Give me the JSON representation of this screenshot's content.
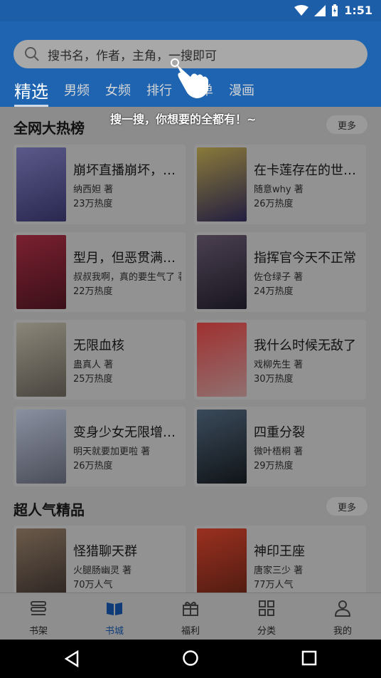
{
  "status": {
    "time": "1:51"
  },
  "search": {
    "placeholder": "搜书名，作者，主角，一搜即可"
  },
  "tabs": [
    "精选",
    "男频",
    "女频",
    "排行",
    "书单",
    "漫画"
  ],
  "guide": {
    "text": "搜一搜，你想要的全都有！~"
  },
  "sections": [
    {
      "title": "全网大热榜",
      "more": "更多",
      "books": [
        {
          "title": "崩坏直播崩坏，芽…",
          "author": "纳西妲 著",
          "heat": "23万热度",
          "cover_color": "#3a3560"
        },
        {
          "title": "在卡莲存在的世界…",
          "author": "随意why 著",
          "heat": "26万热度",
          "cover_color": "#2c2850"
        },
        {
          "title": "型月，但恶贯满盈…",
          "author": "叔叔我啊，真的要生气了 著",
          "heat": "22万热度",
          "cover_color": "#5a1c24"
        },
        {
          "title": "指挥官今天不正常",
          "author": "佐仓绿子 著",
          "heat": "24万热度",
          "cover_color": "#2a2530"
        },
        {
          "title": "无限血核",
          "author": "蛊真人 著",
          "heat": "25万热度",
          "cover_color": "#6e6a60"
        },
        {
          "title": "我什么时候无敌了",
          "author": "戏柳先生 著",
          "heat": "30万热度",
          "cover_color": "#8a2a2a"
        },
        {
          "title": "变身少女无限增殖…",
          "author": "明天就要加更啦 著",
          "heat": "26万热度",
          "cover_color": "#6a7080"
        },
        {
          "title": "四重分裂",
          "author": "微叶梧桐 著",
          "heat": "29万热度",
          "cover_color": "#1e2430"
        }
      ]
    },
    {
      "title": "超人气精品",
      "more": "更多",
      "books": [
        {
          "title": "怪猎聊天群",
          "author": "火腿肠幽灵 著",
          "heat": "70万人气",
          "cover_color": "#4a3e3a"
        },
        {
          "title": "神印王座",
          "author": "唐家三少 著",
          "heat": "77万人气",
          "cover_color": "#6a2820"
        }
      ]
    }
  ],
  "bottom_nav": [
    {
      "label": "书架",
      "icon": "bookshelf-icon",
      "active": false
    },
    {
      "label": "书城",
      "icon": "book-open-icon",
      "active": true
    },
    {
      "label": "福利",
      "icon": "gift-icon",
      "active": false
    },
    {
      "label": "分类",
      "icon": "grid-icon",
      "active": false
    },
    {
      "label": "我的",
      "icon": "person-icon",
      "active": false
    }
  ],
  "colors": {
    "header": "#1e64b0",
    "overlay_bg": "#8c8c8c",
    "nav_active": "#0f3c78"
  }
}
